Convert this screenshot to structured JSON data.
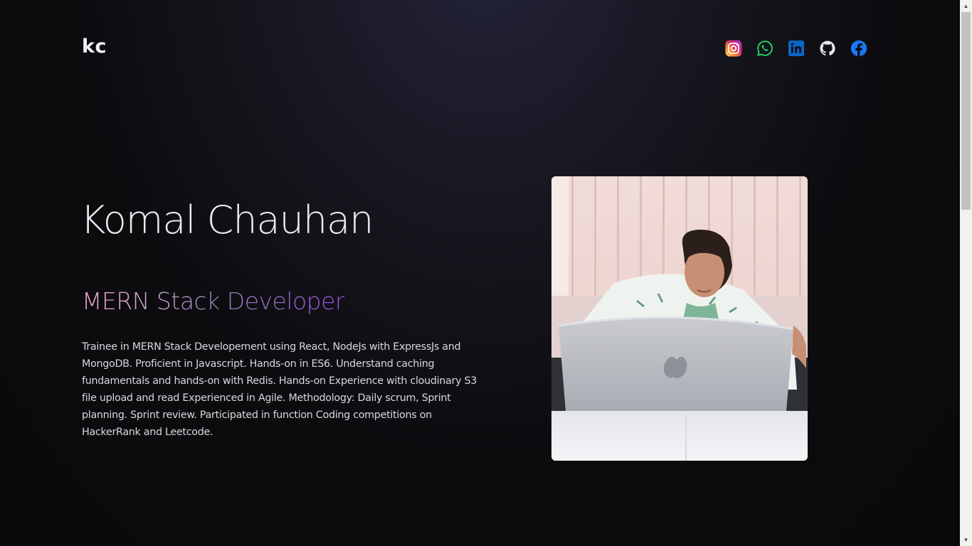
{
  "header": {
    "logo": "kc",
    "socials": [
      {
        "name": "instagram",
        "icon": "instagram-icon",
        "color": "#e1306c"
      },
      {
        "name": "whatsapp",
        "icon": "whatsapp-icon",
        "color": "#25d366"
      },
      {
        "name": "linkedin",
        "icon": "linkedin-icon",
        "color": "#0a66c2"
      },
      {
        "name": "github",
        "icon": "github-icon",
        "color": "#e6e6e6"
      },
      {
        "name": "facebook",
        "icon": "facebook-icon",
        "color": "#1877f2"
      }
    ]
  },
  "hero": {
    "name": "Komal Chauhan",
    "role": "MERN Stack Developer",
    "bio": "Trainee in MERN Stack Developement using React, NodeJs with ExpressJs and MongoDB. Proficient in Javascript. Hands-on in ES6. Understand caching fundamentals and hands-on with Redis. Hands-on Experience with cloudinary S3 file upload and read Experienced in Agile. Methodology: Daily scrum, Sprint planning. Sprint review. Participated in function Coding competitions on HackerRank and Leetcode.",
    "photo": "profile-photo"
  },
  "colors": {
    "background": "#0b0b0e",
    "text": "#e8e8ee",
    "role_gradient": [
      "#f2a7d3",
      "#8d7fb6",
      "#9a4fe2"
    ]
  }
}
